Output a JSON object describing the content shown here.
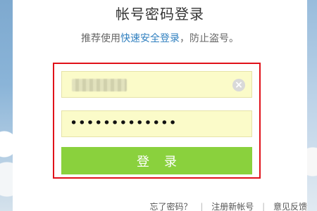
{
  "header": {
    "title": "帐号密码登录",
    "subtitle_prefix": "推荐使用",
    "subtitle_link": "快速安全登录",
    "subtitle_suffix": "，防止盗号。"
  },
  "form": {
    "password_mask": "•••••••••••••",
    "login_label": "登 录"
  },
  "footer": {
    "forgot_password": "忘了密码？",
    "register": "注册新帐号",
    "feedback": "意见反馈",
    "separator": "|"
  },
  "colors": {
    "highlight_border": "#e0111a",
    "input_bg": "#fbfbc9",
    "button_bg": "#8ad13d",
    "link": "#2f7fbf"
  },
  "icons": {
    "clear": "clear-icon"
  }
}
